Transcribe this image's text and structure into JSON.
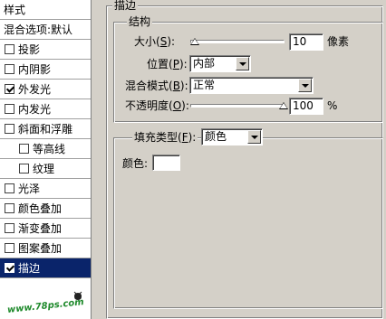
{
  "left_panel": {
    "header": "样式",
    "blend_options": "混合选项:默认",
    "items": [
      {
        "label": "投影",
        "checked": false,
        "indent": false,
        "selected": false
      },
      {
        "label": "内阴影",
        "checked": false,
        "indent": false,
        "selected": false
      },
      {
        "label": "外发光",
        "checked": true,
        "indent": false,
        "selected": false
      },
      {
        "label": "内发光",
        "checked": false,
        "indent": false,
        "selected": false
      },
      {
        "label": "斜面和浮雕",
        "checked": false,
        "indent": false,
        "selected": false
      },
      {
        "label": "等高线",
        "checked": false,
        "indent": true,
        "selected": false
      },
      {
        "label": "纹理",
        "checked": false,
        "indent": true,
        "selected": false
      },
      {
        "label": "光泽",
        "checked": false,
        "indent": false,
        "selected": false
      },
      {
        "label": "颜色叠加",
        "checked": false,
        "indent": false,
        "selected": false
      },
      {
        "label": "渐变叠加",
        "checked": false,
        "indent": false,
        "selected": false
      },
      {
        "label": "图案叠加",
        "checked": false,
        "indent": false,
        "selected": false
      },
      {
        "label": "描边",
        "checked": true,
        "indent": false,
        "selected": true
      }
    ],
    "watermark": "www.78ps.com"
  },
  "stroke": {
    "title": "描边",
    "structure": {
      "title": "结构",
      "size": {
        "label_pre": "大小(",
        "key": "S",
        "label_post": "):",
        "value": "10",
        "unit": "像素",
        "level": 0.04
      },
      "position": {
        "label_pre": "位置(",
        "key": "P",
        "label_post": "):",
        "value": "内部"
      },
      "blend_mode": {
        "label_pre": "混合模式(",
        "key": "B",
        "label_post": "):",
        "value": "正常"
      },
      "opacity": {
        "label_pre": "不透明度(",
        "key": "O",
        "label_post": "):",
        "value": "100",
        "unit": "%",
        "level": 1.0
      }
    },
    "fill": {
      "type_label_pre": "填充类型(",
      "type_key": "F",
      "type_label_post": "):",
      "type_value": "颜色",
      "color_label": "颜色:",
      "color_value": "#ffffff"
    }
  }
}
